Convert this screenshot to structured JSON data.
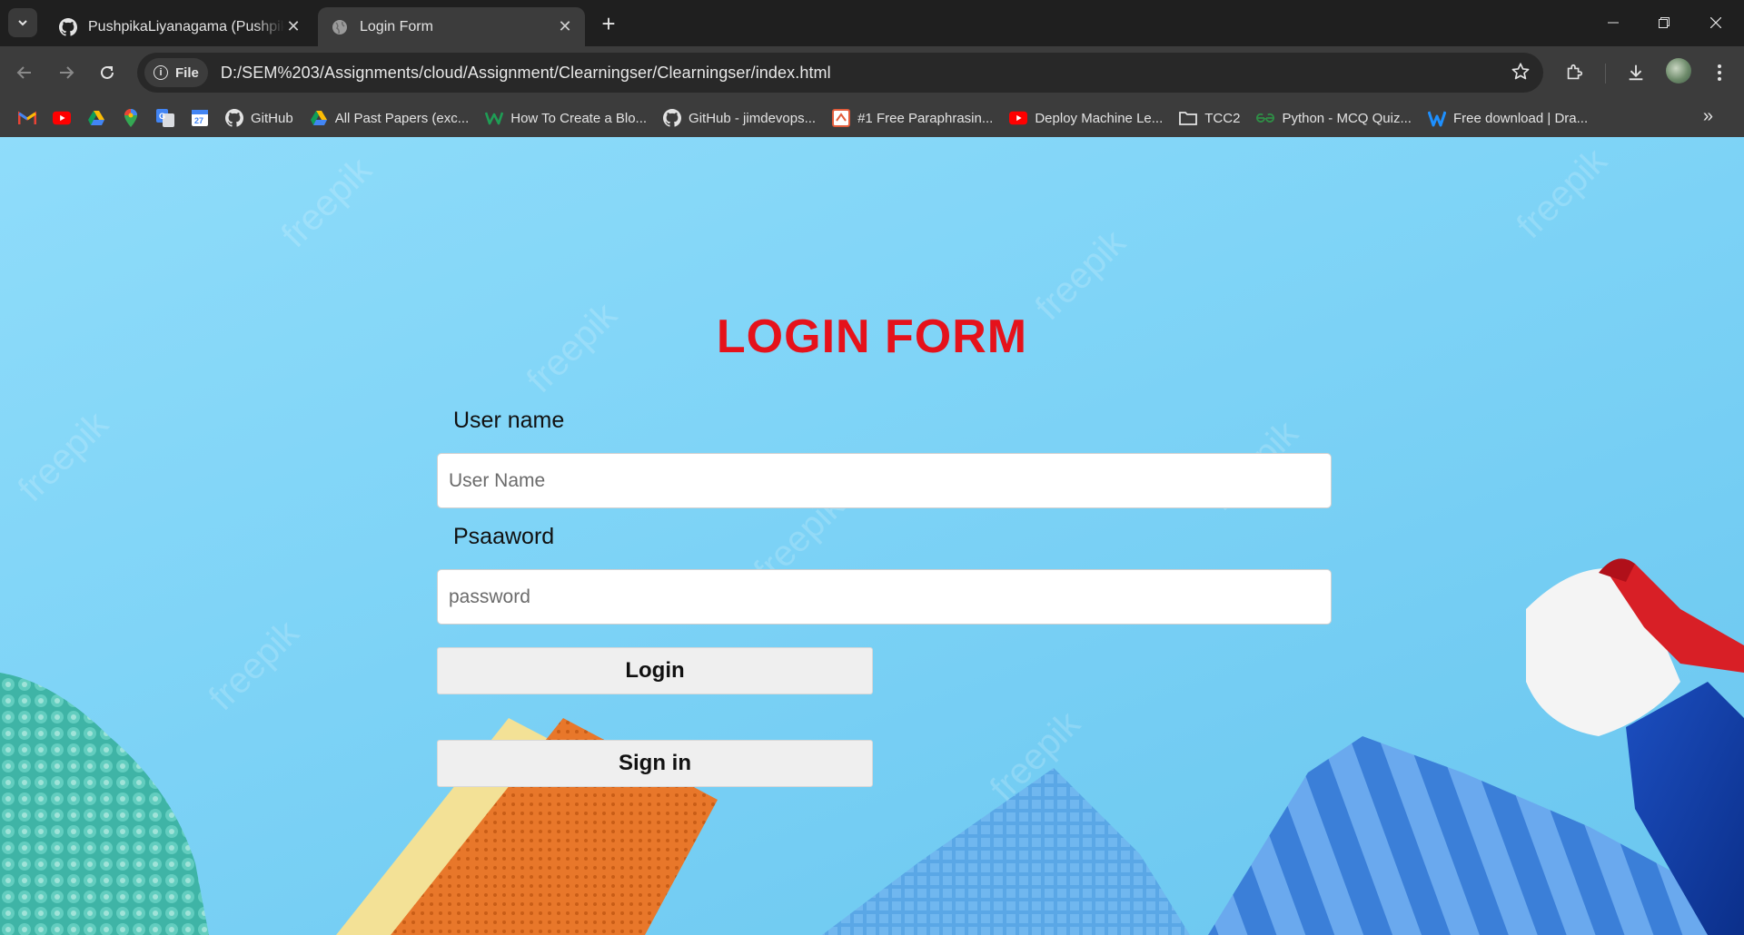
{
  "browser": {
    "tabs": [
      {
        "title": "PushpikaLiyanagama (Pushpika",
        "active": false,
        "icon": "github-icon"
      },
      {
        "title": "Login Form",
        "active": true,
        "icon": "globe-icon"
      }
    ],
    "address_bar": {
      "chip": "File",
      "url": "D:/SEM%203/Assignments/cloud/Assignment/Clearningser/Clearningser/index.html"
    },
    "bookmarks": [
      {
        "label": "",
        "icon": "gmail-icon"
      },
      {
        "label": "",
        "icon": "youtube-icon"
      },
      {
        "label": "",
        "icon": "google-drive-icon"
      },
      {
        "label": "",
        "icon": "google-maps-icon"
      },
      {
        "label": "",
        "icon": "google-translate-icon"
      },
      {
        "label": "",
        "icon": "google-calendar-icon"
      },
      {
        "label": "GitHub",
        "icon": "github-icon"
      },
      {
        "label": "All Past Papers (exc...",
        "icon": "google-drive-icon"
      },
      {
        "label": "How To Create a Blo...",
        "icon": "w-logo-icon"
      },
      {
        "label": "GitHub - jimdevops...",
        "icon": "github-icon"
      },
      {
        "label": "#1 Free Paraphrasin...",
        "icon": "quillbot-icon"
      },
      {
        "label": "Deploy Machine Le...",
        "icon": "youtube-icon"
      },
      {
        "label": "TCC2",
        "icon": "folder-icon"
      },
      {
        "label": "Python - MCQ Quiz...",
        "icon": "geeksforgeeks-icon"
      },
      {
        "label": "Free download | Dra...",
        "icon": "drawio-icon"
      }
    ]
  },
  "page": {
    "heading": "LOGIN FORM",
    "username_label": "User name",
    "username_placeholder": "User Name",
    "password_label": "Psaaword",
    "password_placeholder": "password",
    "login_button": "Login",
    "signin_button": "Sign in",
    "watermark": "freepik"
  },
  "colors": {
    "heading": "#e5121b",
    "background": "#7fd4f7"
  }
}
